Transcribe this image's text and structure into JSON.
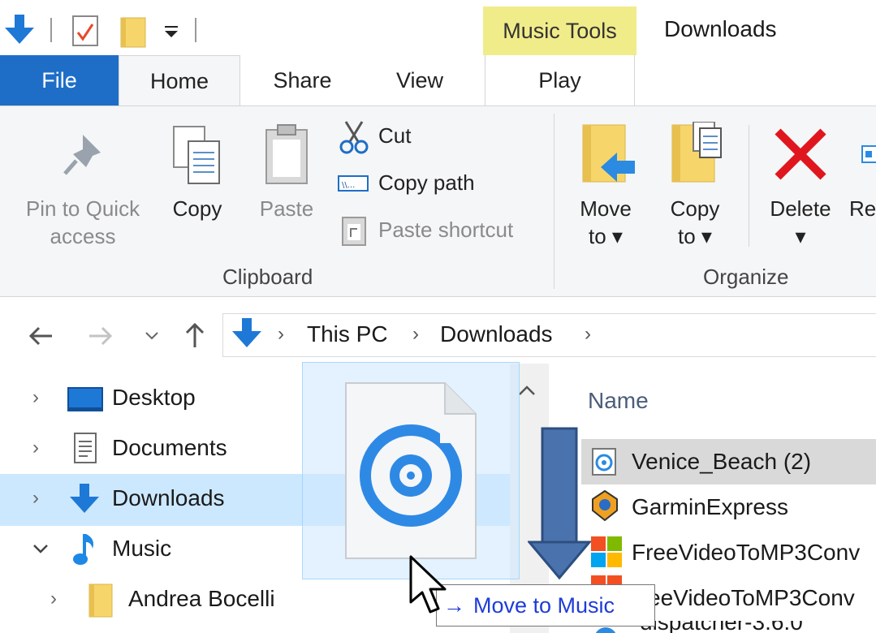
{
  "quick_access": {
    "icons": [
      "download-arrow-icon",
      "properties-icon",
      "new-folder-icon",
      "customize-dropdown-icon"
    ]
  },
  "title_bar": {
    "context_tab": "Music Tools",
    "window_title": "Downloads"
  },
  "tabs": [
    {
      "label": "File"
    },
    {
      "label": "Home"
    },
    {
      "label": "Share"
    },
    {
      "label": "View"
    },
    {
      "label": "Play"
    }
  ],
  "ribbon": {
    "clipboard": {
      "group_label": "Clipboard",
      "pin_line1": "Pin to Quick",
      "pin_line2": "access",
      "copy": "Copy",
      "paste": "Paste",
      "cut": "Cut",
      "copy_path": "Copy path",
      "paste_shortcut": "Paste shortcut"
    },
    "organize": {
      "group_label": "Organize",
      "move_line1": "Move",
      "move_line2": "to",
      "copy_line1": "Copy",
      "copy_line2": "to",
      "delete": "Delete",
      "rename_partial": "Re"
    }
  },
  "address": {
    "crumbs": [
      "This PC",
      "Downloads"
    ]
  },
  "nav_pane": {
    "items": [
      {
        "label": "Desktop",
        "expanded": false
      },
      {
        "label": "Documents",
        "expanded": false
      },
      {
        "label": "Downloads",
        "expanded": false,
        "selected": true
      },
      {
        "label": "Music",
        "expanded": true
      },
      {
        "label": "Andrea Bocelli",
        "expanded": false
      }
    ]
  },
  "file_list": {
    "header_name": "Name",
    "files": [
      {
        "name": "Venice_Beach (2)",
        "selected": true
      },
      {
        "name": "GarminExpress"
      },
      {
        "name": "FreeVideoToMP3Conv"
      },
      {
        "name": "eeVideoToMP3Conv"
      },
      {
        "name": "dispatcher-3.6.0"
      }
    ]
  },
  "drag": {
    "tooltip_arrow": "→",
    "tooltip_text": "Move to Music"
  },
  "colors": {
    "accent": "#1e6ec8",
    "music_tools": "#f1ec8a",
    "selection": "#cce8ff",
    "callout_arrow": "#4a73ad"
  }
}
